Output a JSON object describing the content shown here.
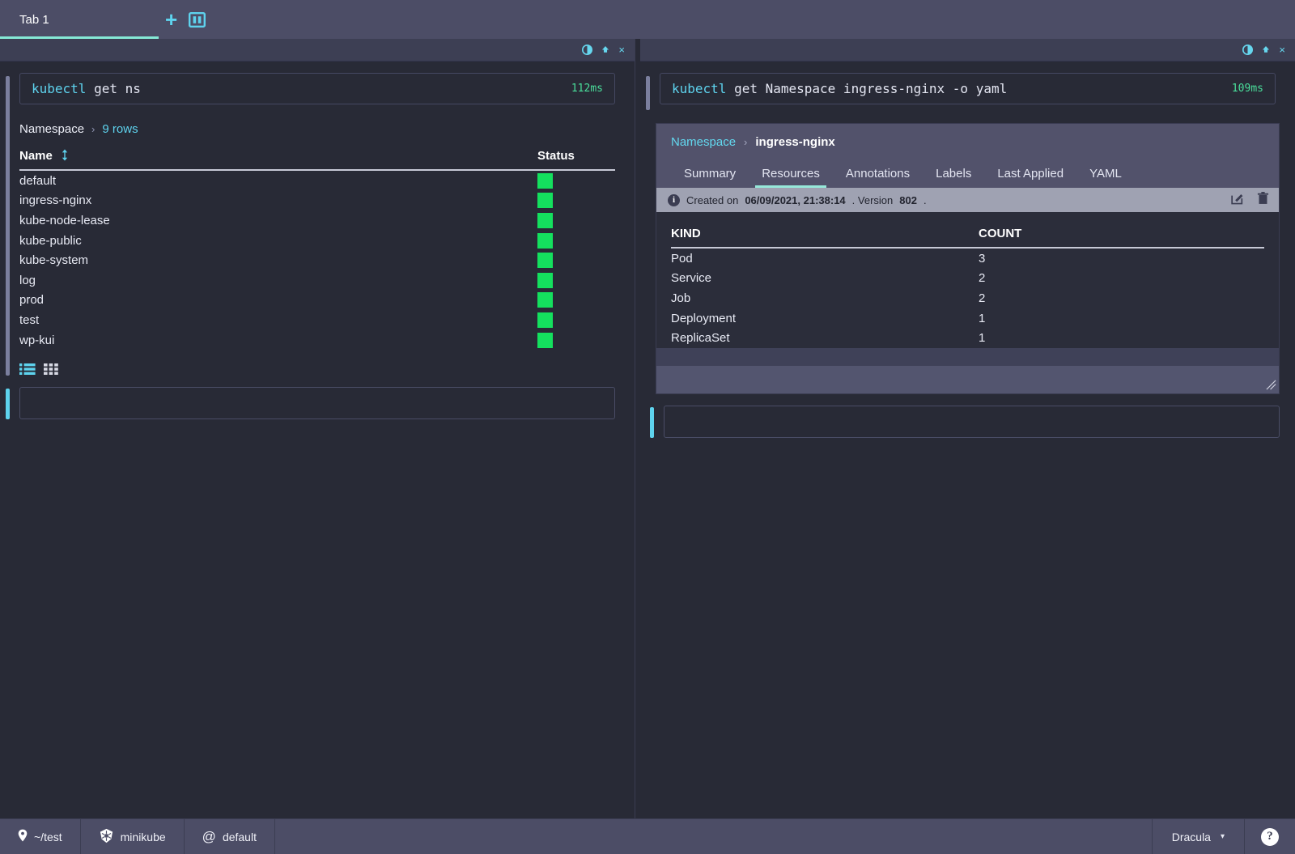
{
  "tabbar": {
    "tabs": [
      {
        "label": "Tab 1",
        "active": true
      }
    ],
    "new_tab_icon": "plus-icon",
    "split_icon": "split-screen-icon"
  },
  "left_pane": {
    "window_controls": [
      {
        "icon": "contrast-icon"
      },
      {
        "icon": "pin-icon"
      },
      {
        "icon": "close-icon",
        "glyph": "×"
      }
    ],
    "command": {
      "keyword": "kubectl",
      "rest": " get ns",
      "duration": "112ms"
    },
    "breadcrumb": {
      "kind": "Namespace",
      "separator": "›",
      "rows": "9 rows"
    },
    "table": {
      "columns": [
        "Name",
        "Status"
      ],
      "sort_icon": "sort-arrows-icon",
      "rows": [
        {
          "name": "default",
          "status": "green"
        },
        {
          "name": "ingress-nginx",
          "status": "green"
        },
        {
          "name": "kube-node-lease",
          "status": "green"
        },
        {
          "name": "kube-public",
          "status": "green"
        },
        {
          "name": "kube-system",
          "status": "green"
        },
        {
          "name": "log",
          "status": "green"
        },
        {
          "name": "prod",
          "status": "green"
        },
        {
          "name": "test",
          "status": "green"
        },
        {
          "name": "wp-kui",
          "status": "green"
        }
      ]
    },
    "view_toggles": [
      {
        "icon": "list-view-icon",
        "active": true
      },
      {
        "icon": "grid-view-icon",
        "active": false
      }
    ],
    "prompt": {
      "value": "",
      "placeholder": ""
    }
  },
  "right_pane": {
    "window_controls": [
      {
        "icon": "contrast-icon"
      },
      {
        "icon": "pin-icon"
      },
      {
        "icon": "close-icon",
        "glyph": "×"
      }
    ],
    "command": {
      "keyword": "kubectl",
      "rest": " get Namespace ingress-nginx -o yaml",
      "duration": "109ms"
    },
    "sidecar": {
      "breadcrumb": {
        "link": "Namespace",
        "separator": "›",
        "current": "ingress-nginx"
      },
      "tabs": [
        {
          "label": "Summary",
          "active": false
        },
        {
          "label": "Resources",
          "active": true
        },
        {
          "label": "Annotations",
          "active": false
        },
        {
          "label": "Labels",
          "active": false
        },
        {
          "label": "Last Applied",
          "active": false
        },
        {
          "label": "YAML",
          "active": false
        }
      ],
      "info": {
        "icon": "info-icon",
        "prefix": "Created on ",
        "date": "06/09/2021, 21:38:14",
        "middle": ". Version ",
        "version": "802",
        "suffix": ".",
        "actions": [
          {
            "icon": "edit-icon",
            "glyph": "✎"
          },
          {
            "icon": "trash-icon",
            "glyph": "🗑"
          }
        ]
      },
      "table": {
        "columns": [
          "KIND",
          "COUNT"
        ],
        "rows": [
          {
            "kind": "Pod",
            "count": "3"
          },
          {
            "kind": "Service",
            "count": "2"
          },
          {
            "kind": "Job",
            "count": "2"
          },
          {
            "kind": "Deployment",
            "count": "1"
          },
          {
            "kind": "ReplicaSet",
            "count": "1"
          }
        ]
      },
      "resize_handle": "resize-grip-icon"
    },
    "prompt": {
      "value": "",
      "placeholder": ""
    }
  },
  "statusbar": {
    "cwd": {
      "icon": "location-pin-icon",
      "label": "~/test"
    },
    "cluster": {
      "icon": "kubernetes-icon",
      "label": "minikube"
    },
    "namespace": {
      "icon": "at-icon",
      "label": "default"
    },
    "theme": {
      "label": "Dracula",
      "caret": "▾"
    },
    "help": {
      "icon": "help-icon",
      "glyph": "?"
    }
  },
  "colors": {
    "background": "#282a36",
    "chrome": "#4c4d66",
    "accent_cyan": "#5ed3ee",
    "accent_mint": "#85e9d6",
    "status_green": "#14e05e",
    "duration_green": "#4ade9b",
    "sidecar_header": "#52526b",
    "info_bar": "#9fa2b2"
  }
}
